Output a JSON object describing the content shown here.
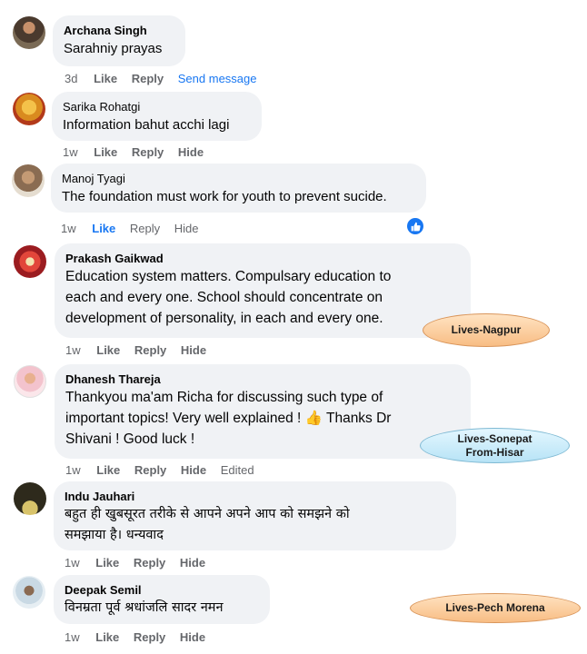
{
  "comments": [
    {
      "name": "Archana Singh",
      "text": "Sarahniy prayas",
      "actions": [
        "3d",
        "Like",
        "Reply",
        "Send message"
      ]
    },
    {
      "name": "Sarika Rohatgi",
      "text": "Information bahut acchi lagi",
      "actions": [
        "1w",
        "Like",
        "Reply",
        "Hide"
      ]
    },
    {
      "name": "Manoj Tyagi",
      "text": "The foundation must work for youth to prevent sucide.",
      "actions": [
        "1w",
        "Like",
        "Reply",
        "Hide"
      ]
    },
    {
      "name": "Prakash Gaikwad",
      "text": "Education system matters. Compulsary education to\neach and every one. School should concentrate on\ndevelopment of personality, in each and every one.",
      "actions": [
        "1w",
        "Like",
        "Reply",
        "Hide"
      ]
    },
    {
      "name": "Dhanesh Thareja",
      "text_before": "Thankyou ma'am Richa for discussing such type of\nimportant topics! Very well explained ! ",
      "emoji": "👍",
      "text_after": " Thanks Dr\nShivani ! Good luck !",
      "actions": [
        "1w",
        "Like",
        "Reply",
        "Hide",
        "Edited"
      ]
    },
    {
      "name": "Indu Jauhari",
      "text": "बहुत ही खुबसूरत तरीके से आपने अपने आप को समझने को\nसमझाया है। धन्यवाद",
      "actions": [
        "1w",
        "Like",
        "Reply",
        "Hide"
      ]
    },
    {
      "name": "Deepak Semil",
      "text": "विनम्रता पूर्व श्रधांजलि सादर नमन",
      "actions": [
        "1w",
        "Like",
        "Reply",
        "Hide"
      ]
    }
  ],
  "tags": {
    "nagpur": "Lives-Nagpur",
    "sonepat_line1": "Lives-Sonepat",
    "sonepat_line2": "From-Hisar",
    "pech": "Lives-Pech Morena"
  },
  "colors": {
    "bubble": "#f0f2f5",
    "link": "#1877f2",
    "muted": "#65676b"
  }
}
